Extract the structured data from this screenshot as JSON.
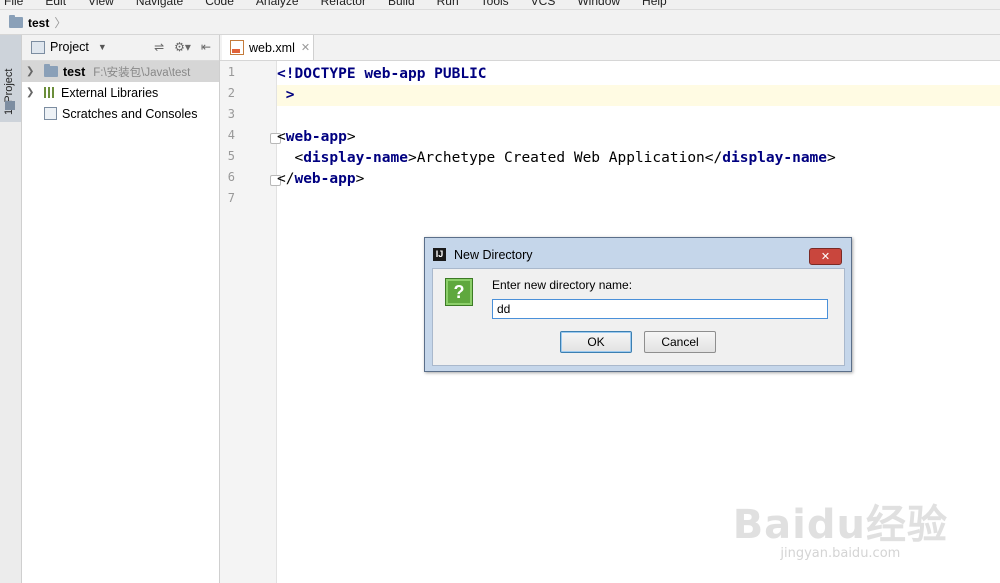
{
  "menu": [
    "File",
    "Edit",
    "View",
    "Navigate",
    "Code",
    "Analyze",
    "Refactor",
    "Build",
    "Run",
    "Tools",
    "VCS",
    "Window",
    "Help"
  ],
  "navbar": {
    "project": "test"
  },
  "toolstrip": {
    "tab_label": "1: Project"
  },
  "project_panel": {
    "title": "Project",
    "tree": [
      {
        "label": "test",
        "path": "F:\\安装包\\Java\\test",
        "selected": true
      },
      {
        "label": "External Libraries"
      },
      {
        "label": "Scratches and Consoles"
      }
    ]
  },
  "editor": {
    "tab": "web.xml",
    "line_numbers": [
      "1",
      "2",
      "3",
      "4",
      "5",
      "6",
      "7"
    ],
    "lines": [
      {
        "parts": [
          [
            "kw",
            "<!DOCTYPE "
          ],
          [
            "kw",
            "web-app "
          ],
          [
            "kw",
            "PUBLIC"
          ]
        ]
      },
      {
        "parts": [
          [
            "kw",
            " >"
          ]
        ]
      },
      {
        "parts": []
      },
      {
        "parts": [
          [
            "txt",
            "<"
          ],
          [
            "kw",
            "web-app"
          ],
          [
            "txt",
            ">"
          ]
        ]
      },
      {
        "parts": [
          [
            "txt",
            "  <"
          ],
          [
            "kw",
            "display-name"
          ],
          [
            "txt",
            ">Archetype Created Web Application</"
          ],
          [
            "kw",
            "display-name"
          ],
          [
            "txt",
            ">"
          ]
        ]
      },
      {
        "parts": [
          [
            "txt",
            "</"
          ],
          [
            "kw",
            "web-app"
          ],
          [
            "txt",
            ">"
          ]
        ]
      },
      {
        "parts": []
      }
    ]
  },
  "dialog": {
    "title": "New Directory",
    "prompt": "Enter new directory name:",
    "value": "dd",
    "ok": "OK",
    "cancel": "Cancel",
    "icon_glyph": "?",
    "app_glyph": "IJ"
  },
  "watermark": {
    "logo": "Baidu经验",
    "url": "jingyan.baidu.com"
  }
}
